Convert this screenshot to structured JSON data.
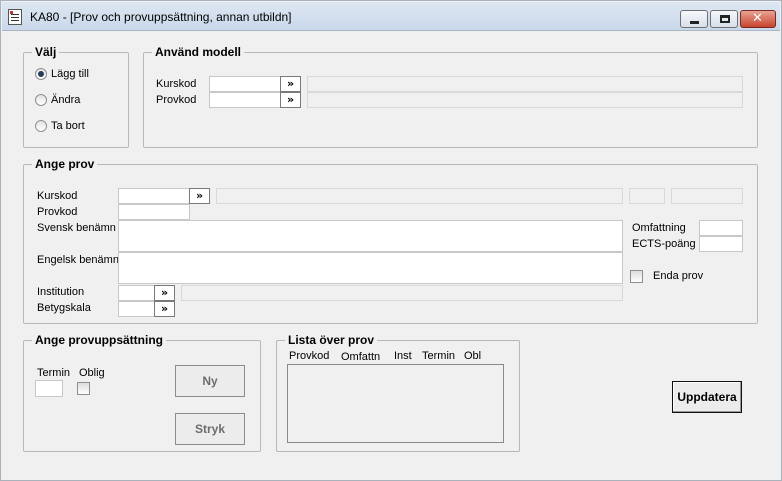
{
  "window": {
    "title": "KA80 - [Prov och provuppsättning, annan utbildn]"
  },
  "valj": {
    "legend": "Välj",
    "options": [
      {
        "label": "Lägg till",
        "checked": true
      },
      {
        "label": "Ändra",
        "checked": false
      },
      {
        "label": "Ta bort",
        "checked": false
      }
    ]
  },
  "anvand_modell": {
    "legend": "Använd modell",
    "kurskod_label": "Kurskod",
    "provkod_label": "Provkod",
    "arrow": "»"
  },
  "ange_prov": {
    "legend": "Ange prov",
    "kurskod_label": "Kurskod",
    "provkod_label": "Provkod",
    "svensk_label": "Svensk benämn",
    "engelsk_label": "Engelsk benämn",
    "institution_label": "Institution",
    "betygskala_label": "Betygskala",
    "omfattning_label": "Omfattning",
    "ects_label": "ECTS-poäng",
    "enda_prov_label": "Enda prov",
    "arrow": "»"
  },
  "ange_provuppsattning": {
    "legend": "Ange provuppsättning",
    "termin_label": "Termin",
    "oblig_label": "Oblig",
    "ny_label": "Ny",
    "stryk_label": "Stryk"
  },
  "lista_over_prov": {
    "legend": "Lista över prov",
    "columns": [
      "Provkod",
      "Omfattn",
      "Inst",
      "Termin",
      "Obl"
    ]
  },
  "uppdatera_label": "Uppdatera"
}
